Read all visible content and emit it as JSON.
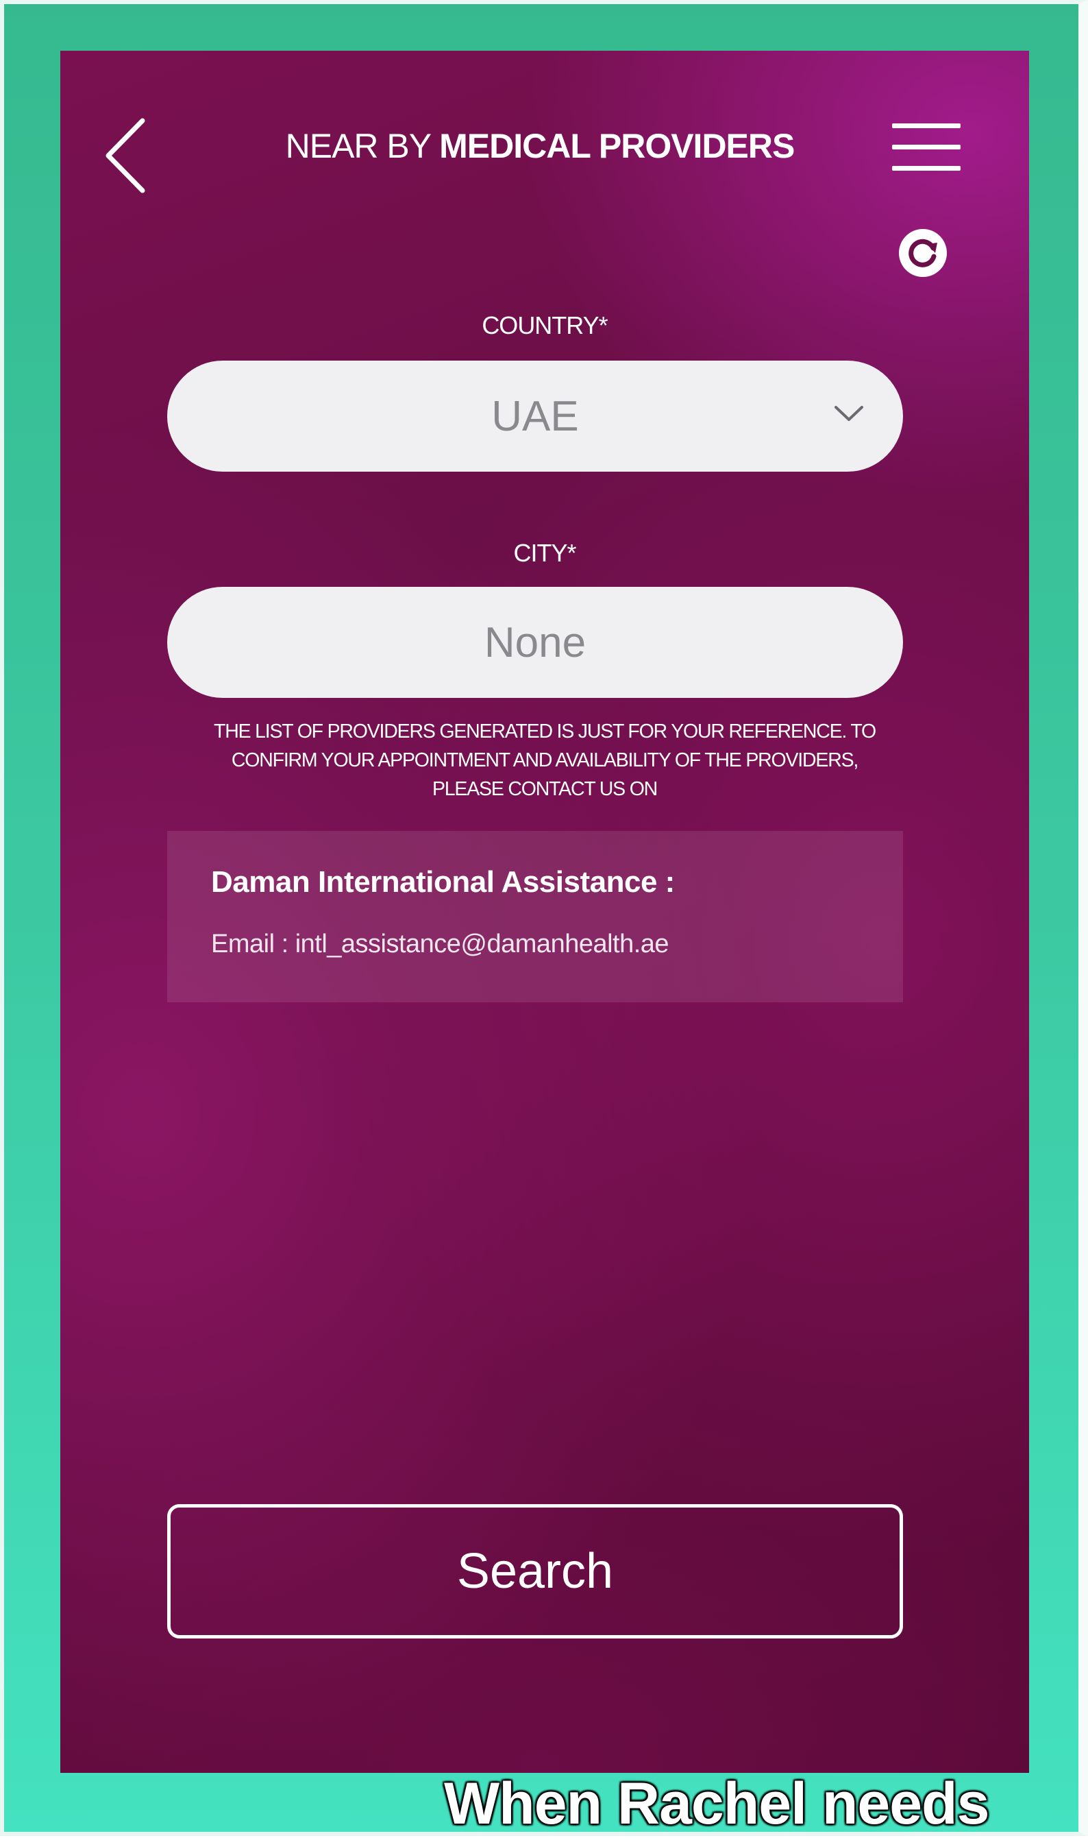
{
  "header": {
    "title_light": "NEAR BY ",
    "title_bold": "MEDICAL PROVIDERS",
    "back_icon": "chevron-left-icon",
    "menu_icon": "hamburger-menu-icon",
    "refresh_icon": "refresh-icon"
  },
  "form": {
    "country": {
      "label": "COUNTRY*",
      "value": "UAE",
      "dropdown_icon": "chevron-down-icon"
    },
    "city": {
      "label": "CITY*",
      "value": "None"
    }
  },
  "disclaimer": {
    "line1": "THE LIST OF PROVIDERS GENERATED IS JUST FOR YOUR REFERENCE. TO",
    "line2": "CONFIRM YOUR APPOINTMENT AND AVAILABILITY OF THE PROVIDERS,",
    "line3": "PLEASE CONTACT US ON"
  },
  "contact": {
    "title": "Daman International Assistance :",
    "email_line": "Email : intl_assistance@damanhealth.ae"
  },
  "search_label": "Search",
  "caption": "When Rachel needs",
  "colors": {
    "frame": "#3cc9a2",
    "background": "#6b0f48",
    "pill": "#f0f0f2",
    "text": "#ffffff"
  }
}
